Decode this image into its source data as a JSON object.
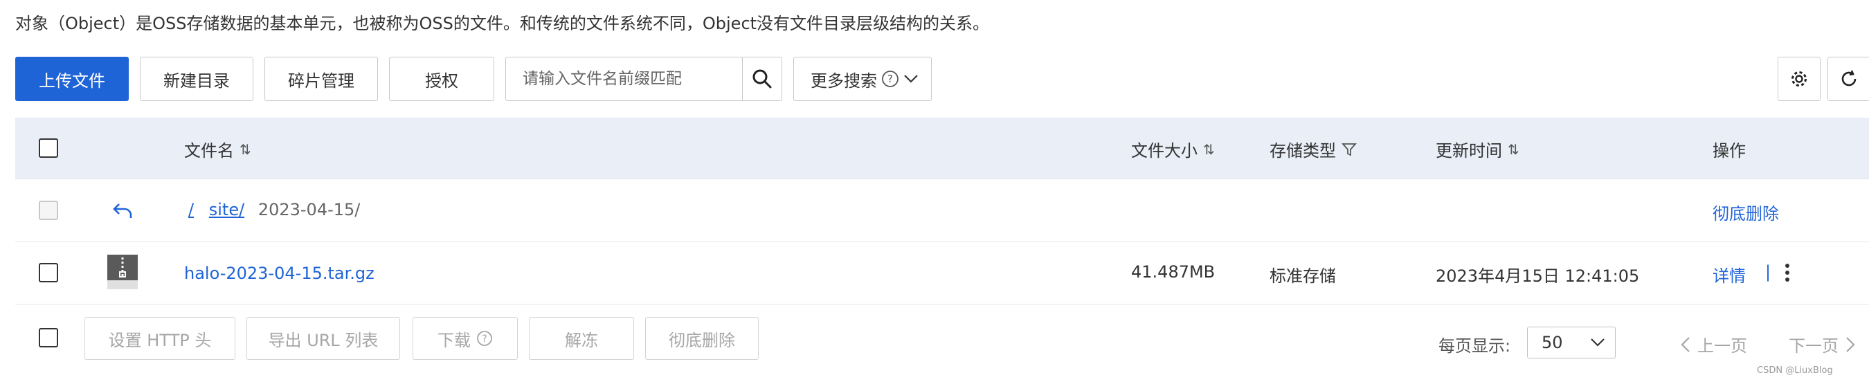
{
  "description": "对象（Object）是OSS存储数据的基本单元，也被称为OSS的文件。和传统的文件系统不同，Object没有文件目录层级结构的关系。",
  "toolbar": {
    "upload": "上传文件",
    "new_dir": "新建目录",
    "fragments": "碎片管理",
    "authorize": "授权",
    "search_placeholder": "请输入文件名前缀匹配",
    "more_search": "更多搜索"
  },
  "columns": {
    "name": "文件名",
    "size": "文件大小",
    "storage": "存储类型",
    "updated": "更新时间",
    "actions": "操作"
  },
  "path_row": {
    "root": "/",
    "site": "site/",
    "current": "2023-04-15/",
    "action": "彻底删除"
  },
  "files": [
    {
      "name": "halo-2023-04-15.tar.gz",
      "size": "41.487MB",
      "storage": "标准存储",
      "updated": "2023年4月15日 12:41:05",
      "detail": "详情",
      "sep": "|"
    }
  ],
  "footer": {
    "set_http": "设置 HTTP 头",
    "export_url": "导出 URL 列表",
    "download": "下载",
    "unfreeze": "解冻",
    "delete": "彻底删除",
    "per_page_label": "每页显示:",
    "per_page_value": "50",
    "prev": "上一页",
    "next": "下一页"
  },
  "watermark": "CSDN @LiuxBlog",
  "colors": {
    "primary": "#1f64d7",
    "header_bg": "#e9eef7"
  }
}
